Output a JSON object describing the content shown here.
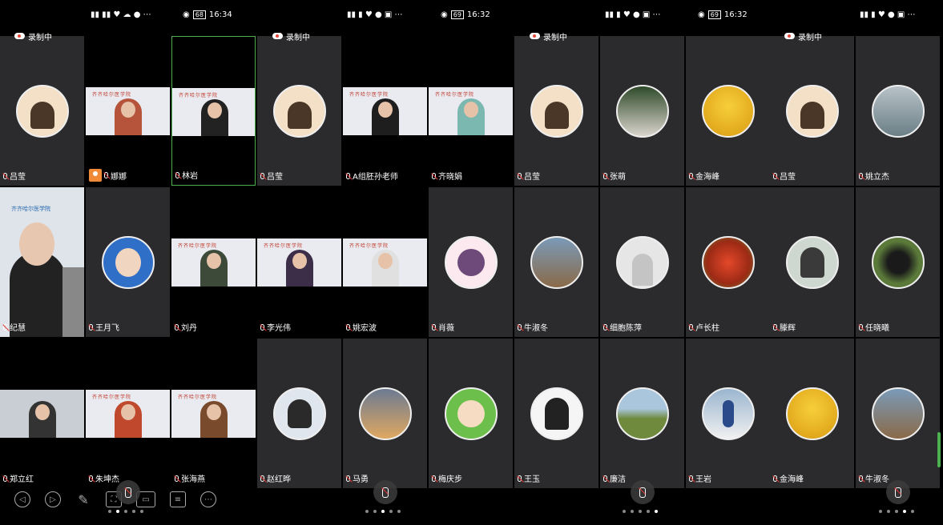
{
  "screens": [
    {
      "time": "16:34",
      "battery": "68"
    },
    {
      "time": "16:32",
      "battery": "69"
    },
    {
      "time": "16:32",
      "battery": "69"
    },
    {
      "time": "",
      "battery": ""
    }
  ],
  "recording_label": "录制中",
  "participants": {
    "p1": "吕莹",
    "p2": "娜娜",
    "p3": "林岩",
    "p4": "纪慧",
    "p5": "王月飞",
    "p6": "刘丹",
    "p7": "郑立红",
    "p8": "朱坤杰",
    "p9": "张海燕",
    "p10": "吕莹",
    "p11": "A组胚孙老师",
    "p12": "齐晓娟",
    "p13": "李光伟",
    "p14": "姚宏波",
    "p15": "赵红晔",
    "p16": "马勇",
    "p17": "梅庆步",
    "p18": "吕莹",
    "p19": "张萌",
    "p20": "金海峰",
    "p21": "肖薇",
    "p22": "牛淑冬",
    "p23": "细胞陈萍",
    "p24": "王玉",
    "p25": "廉洁",
    "p26": "吕莹",
    "p27": "姚立杰",
    "p28": "卢长柱",
    "p29": "滕辉",
    "p30": "任晓曦",
    "p31": "王岩",
    "p32": "金海峰",
    "p33": "牛淑冬"
  },
  "school_banner": "齐齐哈尔医学院",
  "colors": {
    "tile": "#2b2b2d",
    "active_border": "#4caf50",
    "host_badge": "#f08a36"
  }
}
